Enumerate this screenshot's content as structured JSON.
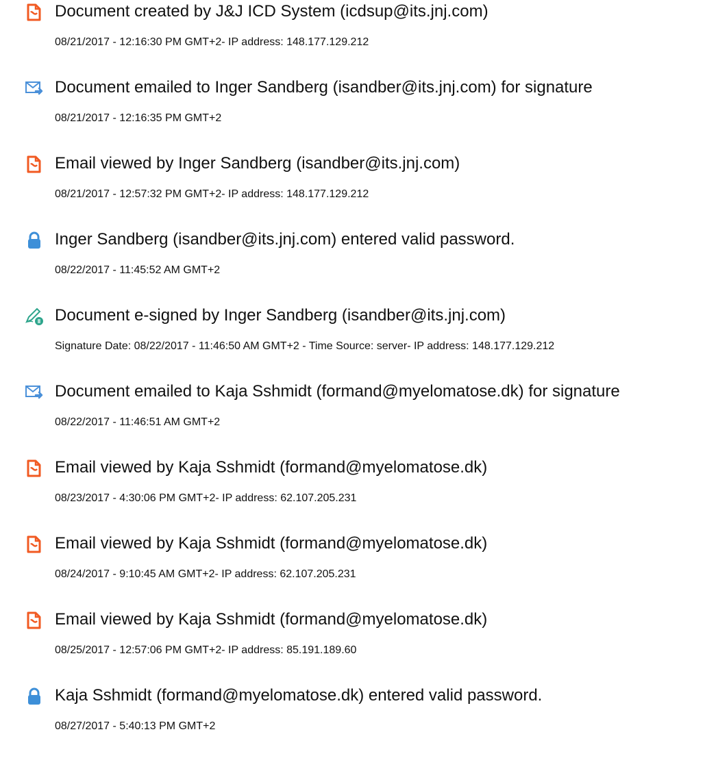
{
  "colors": {
    "doc_icon": "#f15a22",
    "email_icon": "#4a90d9",
    "lock_icon": "#3d8fd8",
    "esign_icon": "#2ea58c"
  },
  "entries": [
    {
      "icon": "document-icon",
      "title": "Document created by J&J ICD System (icdsup@its.jnj.com)",
      "detail": "08/21/2017 - 12:16:30 PM GMT+2- IP address: 148.177.129.212"
    },
    {
      "icon": "email-sent-icon",
      "title": "Document emailed to Inger Sandberg (isandber@its.jnj.com) for signature",
      "detail": "08/21/2017 - 12:16:35 PM GMT+2"
    },
    {
      "icon": "document-icon",
      "title": "Email viewed by Inger Sandberg (isandber@its.jnj.com)",
      "detail": "08/21/2017 - 12:57:32 PM GMT+2- IP address: 148.177.129.212"
    },
    {
      "icon": "lock-icon",
      "title": "Inger Sandberg (isandber@its.jnj.com) entered valid password.",
      "detail": "08/22/2017 - 11:45:52 AM GMT+2"
    },
    {
      "icon": "esign-pen-icon",
      "title": "Document e-signed by Inger Sandberg (isandber@its.jnj.com)",
      "detail": "Signature Date: 08/22/2017 - 11:46:50 AM GMT+2 - Time Source: server- IP address: 148.177.129.212"
    },
    {
      "icon": "email-sent-icon",
      "title": "Document emailed to Kaja Sshmidt (formand@myelomatose.dk) for signature",
      "detail": "08/22/2017 - 11:46:51 AM GMT+2"
    },
    {
      "icon": "document-icon",
      "title": "Email viewed by Kaja Sshmidt (formand@myelomatose.dk)",
      "detail": "08/23/2017 - 4:30:06 PM GMT+2- IP address: 62.107.205.231"
    },
    {
      "icon": "document-icon",
      "title": "Email viewed by Kaja Sshmidt (formand@myelomatose.dk)",
      "detail": "08/24/2017 - 9:10:45 AM GMT+2- IP address: 62.107.205.231"
    },
    {
      "icon": "document-icon",
      "title": "Email viewed by Kaja Sshmidt (formand@myelomatose.dk)",
      "detail": "08/25/2017 - 12:57:06 PM GMT+2- IP address: 85.191.189.60"
    },
    {
      "icon": "lock-icon",
      "title": "Kaja Sshmidt (formand@myelomatose.dk) entered valid password.",
      "detail": "08/27/2017 - 5:40:13 PM GMT+2"
    }
  ]
}
